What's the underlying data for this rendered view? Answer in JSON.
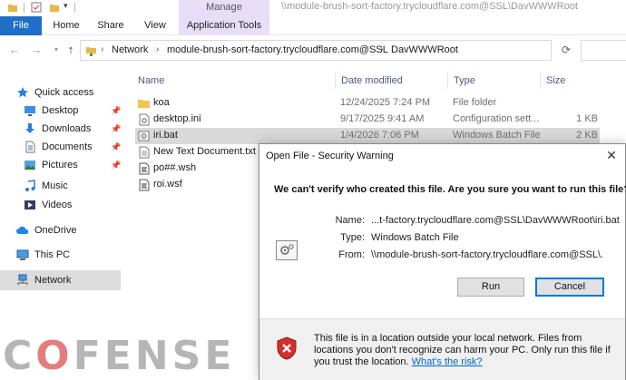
{
  "titlebar": {
    "contextual_tab": "Manage",
    "path": "\\\\module-brush-sort-factory.trycloudflare.com@SSL\\DavWWWRoot"
  },
  "ribbon": {
    "tabs": [
      {
        "label": "File"
      },
      {
        "label": "Home"
      },
      {
        "label": "Share"
      },
      {
        "label": "View"
      },
      {
        "label": "Application Tools"
      }
    ]
  },
  "address_bar": {
    "crumbs": [
      "Network",
      "module-brush-sort-factory.trycloudflare.com@SSL",
      "DavWWWRoot"
    ]
  },
  "sidebar": {
    "items": [
      {
        "label": "Quick access",
        "icon": "star-icon",
        "pinned": false
      },
      {
        "label": "Desktop",
        "icon": "desktop-icon",
        "pinned": true
      },
      {
        "label": "Downloads",
        "icon": "download-icon",
        "pinned": true
      },
      {
        "label": "Documents",
        "icon": "document-icon",
        "pinned": true
      },
      {
        "label": "Pictures",
        "icon": "picture-icon",
        "pinned": true
      },
      {
        "label": "Music",
        "icon": "music-icon",
        "pinned": false
      },
      {
        "label": "Videos",
        "icon": "video-icon",
        "pinned": false
      },
      {
        "label": "OneDrive",
        "icon": "cloud-icon",
        "pinned": false
      },
      {
        "label": "This PC",
        "icon": "computer-icon",
        "pinned": false
      },
      {
        "label": "Network",
        "icon": "network-icon",
        "pinned": false,
        "selected": true
      }
    ]
  },
  "file_list": {
    "columns": [
      "Name",
      "Date modified",
      "Type",
      "Size"
    ],
    "rows": [
      {
        "name": "koa",
        "date": "12/24/2025 7:24 PM",
        "type": "File folder",
        "size": "",
        "icon": "folder-icon"
      },
      {
        "name": "desktop.ini",
        "date": "9/17/2025 9:41 AM",
        "type": "Configuration sett...",
        "size": "1 KB",
        "icon": "settings-file-icon"
      },
      {
        "name": "iri.bat",
        "date": "1/4/2026 7:06 PM",
        "type": "Windows Batch File",
        "size": "2 KB",
        "icon": "batch-file-icon",
        "selected": true
      },
      {
        "name": "New Text Document.txt",
        "date": "",
        "type": "",
        "size": "",
        "icon": "text-file-icon"
      },
      {
        "name": "po##.wsh",
        "date": "",
        "type": "",
        "size": "",
        "icon": "script-file-icon"
      },
      {
        "name": "roi.wsf",
        "date": "",
        "type": "",
        "size": "",
        "icon": "script-file-icon"
      }
    ]
  },
  "dialog": {
    "title": "Open File - Security Warning",
    "close_glyph": "✕",
    "question": "We can't verify who created this file. Are you sure you want to run this file?",
    "name_label": "Name:",
    "name_value": "...t-factory.trycloudflare.com@SSL\\DavWWWRoot\\iri.bat",
    "type_label": "Type:",
    "type_value": "Windows Batch File",
    "from_label": "From:",
    "from_value": "\\\\module-brush-sort-factory.trycloudflare.com@SSL\\...",
    "run_label": "Run",
    "cancel_label": "Cancel",
    "warning_text": "This file is in a location outside your local network. Files from locations you don't recognize can harm your PC. Only run this file if you trust the location.",
    "warning_link": "What's the risk?"
  },
  "watermark": {
    "part1": "C",
    "part2": "O",
    "part3": "FENSE"
  },
  "colors": {
    "accent": "#1e6fc7",
    "manage_tab": "#e8def7",
    "default_button_border": "#0078d7",
    "shield_red": "#d32f2f"
  }
}
